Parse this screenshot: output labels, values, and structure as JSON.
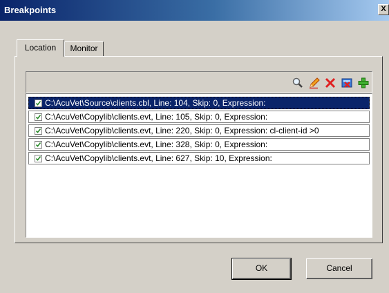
{
  "window": {
    "title": "Breakpoints",
    "close_label": "X"
  },
  "tabs": [
    {
      "label": "Location",
      "active": true
    },
    {
      "label": "Monitor",
      "active": false
    }
  ],
  "toolbar": {
    "buttons": [
      {
        "icon": "magnifier-icon"
      },
      {
        "icon": "pencil-icon"
      },
      {
        "icon": "delete-x-icon"
      },
      {
        "icon": "clear-all-icon"
      },
      {
        "icon": "add-plus-icon"
      }
    ]
  },
  "breakpoints": [
    {
      "text": "C:\\AcuVet\\Source\\clients.cbl, Line: 104, Skip: 0, Expression:",
      "checked": true,
      "selected": true
    },
    {
      "text": "C:\\AcuVet\\Copylib\\clients.evt, Line: 105, Skip: 0, Expression:",
      "checked": true,
      "selected": false
    },
    {
      "text": "C:\\AcuVet\\Copylib\\clients.evt, Line: 220, Skip: 0, Expression: cl-client-id >0",
      "checked": true,
      "selected": false
    },
    {
      "text": "C:\\AcuVet\\Copylib\\clients.evt, Line: 328, Skip: 0, Expression:",
      "checked": true,
      "selected": false
    },
    {
      "text": "C:\\AcuVet\\Copylib\\clients.evt, Line: 627, Skip: 10, Expression:",
      "checked": true,
      "selected": false
    }
  ],
  "buttons": {
    "ok_label": "OK",
    "cancel_label": "Cancel"
  },
  "colors": {
    "selection": "#0a246a",
    "title_start": "#0a246a",
    "dialog_bg": "#d4d0c8"
  }
}
